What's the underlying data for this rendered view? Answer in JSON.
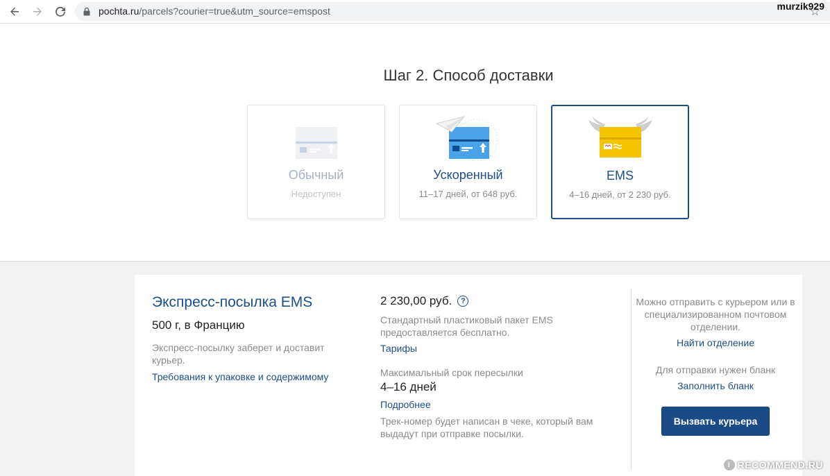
{
  "browser": {
    "url_host": "pochta.ru",
    "url_path": "/parcels?courier=true&utm_source=emspost",
    "user": "murzik929"
  },
  "page": {
    "step_title": "Шаг 2. Способ доставки"
  },
  "cards": [
    {
      "title": "Обычный",
      "subtitle": "Недоступен",
      "state": "disabled"
    },
    {
      "title": "Ускоренный",
      "subtitle": "11–17 дней, от 648 руб.",
      "state": "normal"
    },
    {
      "title": "EMS",
      "subtitle": "4–16 дней, от 2 230 руб.",
      "state": "selected"
    }
  ],
  "details": {
    "title": "Экспресс-посылка EMS",
    "weight": "500 г, в Францию",
    "description": "Экспресс-посылку заберет и доставит курьер.",
    "requirements_link": "Требования к упаковке и содержимому",
    "price": "2 230,00 руб.",
    "help": "?",
    "package_note": "Стандартный пластиковый пакет EMS предоставляется бесплатно.",
    "tariffs_link": "Тарифы",
    "max_term_label": "Максимальный срок пересылки",
    "max_term_value": "4–16 дней",
    "more_link": "Подробнее",
    "track_note": "Трек-номер будет написан в чеке, который вам выдадут при отправке посылки.",
    "courier_info": "Можно отправить с курьером или в специализированном почтовом отделении.",
    "find_office_link": "Найти отделение",
    "form_note": "Для отправки нужен бланк",
    "fill_form_link": "Заполнить бланк",
    "courier_button": "Вызвать курьера"
  },
  "watermark": "RECOMMEND.RU",
  "colors": {
    "accent": "#1c4e87",
    "button": "#1a4b86",
    "ems_yellow": "#f5c400",
    "fast_blue": "#4aa3e8"
  },
  "icons": [
    "back-arrow-icon",
    "forward-arrow-icon",
    "reload-icon",
    "lock-icon",
    "star-icon",
    "help-icon"
  ]
}
